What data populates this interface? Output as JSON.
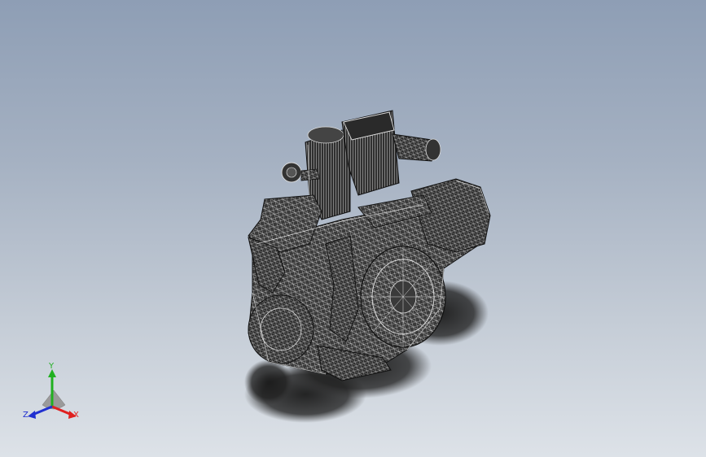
{
  "viewport": {
    "model_name": "engine-assembly",
    "display_style": "wireframe"
  },
  "triad": {
    "x_label": "X",
    "y_label": "Y",
    "z_label": "Z",
    "colors": {
      "x": "#e02020",
      "y": "#20b020",
      "z": "#2030d0"
    }
  }
}
